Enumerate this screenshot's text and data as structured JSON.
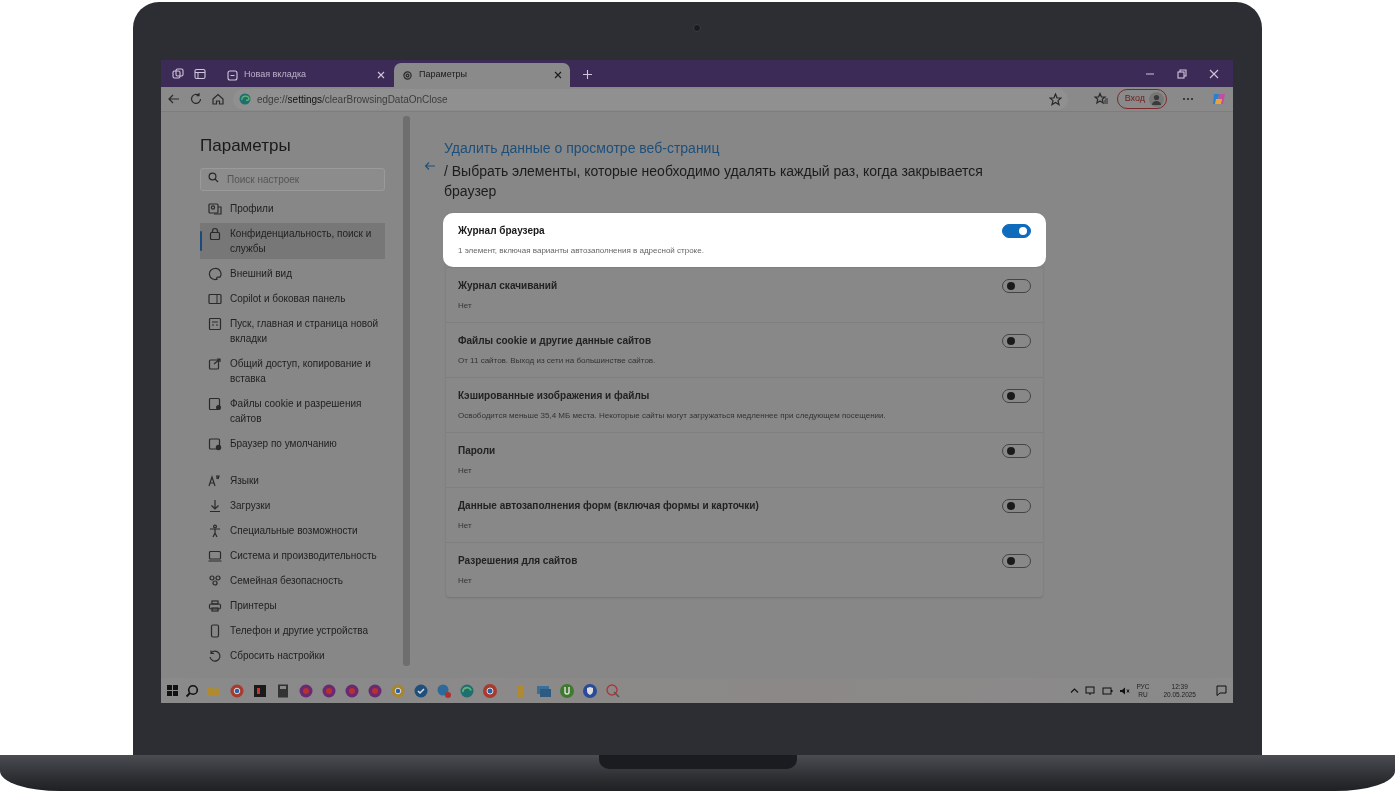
{
  "tabs": [
    {
      "label": "Новая вкладка",
      "selected": false
    },
    {
      "label": "Параметры",
      "selected": true
    }
  ],
  "address_bar": {
    "url": "edge://**settings**/clearBrowsingDataOnClose"
  },
  "sign_in": "Вход",
  "sidebar": {
    "title": "Параметры",
    "search": {
      "placeholder": "Поиск настроек"
    },
    "groups": [
      [
        {
          "label": "Профили",
          "selected": false
        },
        {
          "label": "Конфиденциальность, поиск и службы",
          "selected": true
        },
        {
          "label": "Внешний вид",
          "selected": false
        },
        {
          "label": "Copilot и боковая панель",
          "selected": false
        },
        {
          "label": "Пуск, главная и страница новой вкладки",
          "selected": false
        },
        {
          "label": "Общий доступ, копирование и вставка",
          "selected": false
        },
        {
          "label": "Файлы cookie и разрешения сайтов",
          "selected": false
        },
        {
          "label": "Браузер по умолчанию",
          "selected": false
        }
      ],
      [
        {
          "label": "Языки",
          "selected": false
        },
        {
          "label": "Загрузки",
          "selected": false
        },
        {
          "label": "Специальные возможности",
          "selected": false
        },
        {
          "label": "Система и производительность",
          "selected": false
        },
        {
          "label": "Семейная безопасность",
          "selected": false
        },
        {
          "label": "Принтеры",
          "selected": false
        },
        {
          "label": "Телефон и другие устройства",
          "selected": false
        },
        {
          "label": "Сбросить настройки",
          "selected": false
        }
      ]
    ]
  },
  "content": {
    "breadcrumb_link": "Удалить данные о просмотре веб-страниц",
    "title": "/ Выбрать элементы, которые необходимо удалять каждый раз, когда закрывается браузер",
    "options": [
      {
        "title": "Журнал браузера",
        "description": "1 элемент, включая варианты автозаполнения в адресной строке.",
        "on": true,
        "highlighted": true
      },
      {
        "title": "Журнал скачиваний",
        "description": "Нет",
        "on": false,
        "highlighted": false
      },
      {
        "title": "Файлы cookie и другие данные сайтов",
        "description": "От 11 сайтов. Выход из сети на большинстве сайтов.",
        "on": false,
        "highlighted": false
      },
      {
        "title": "Кэшированные изображения и файлы",
        "description": "Освободится меньше 35,4 МБ места. Некоторые сайты могут загружаться медленнее при следующем посещении.",
        "on": false,
        "highlighted": false
      },
      {
        "title": "Пароли",
        "description": "Нет",
        "on": false,
        "highlighted": false
      },
      {
        "title": "Данные автозаполнения форм (включая формы и карточки)",
        "description": "Нет",
        "on": false,
        "highlighted": false
      },
      {
        "title": "Разрешения для сайтов",
        "description": "Нет",
        "on": false,
        "highlighted": false
      }
    ]
  },
  "taskbar": {
    "language": "РУС",
    "layout": "RU",
    "time": "12:39",
    "date": "20.05.2025"
  }
}
